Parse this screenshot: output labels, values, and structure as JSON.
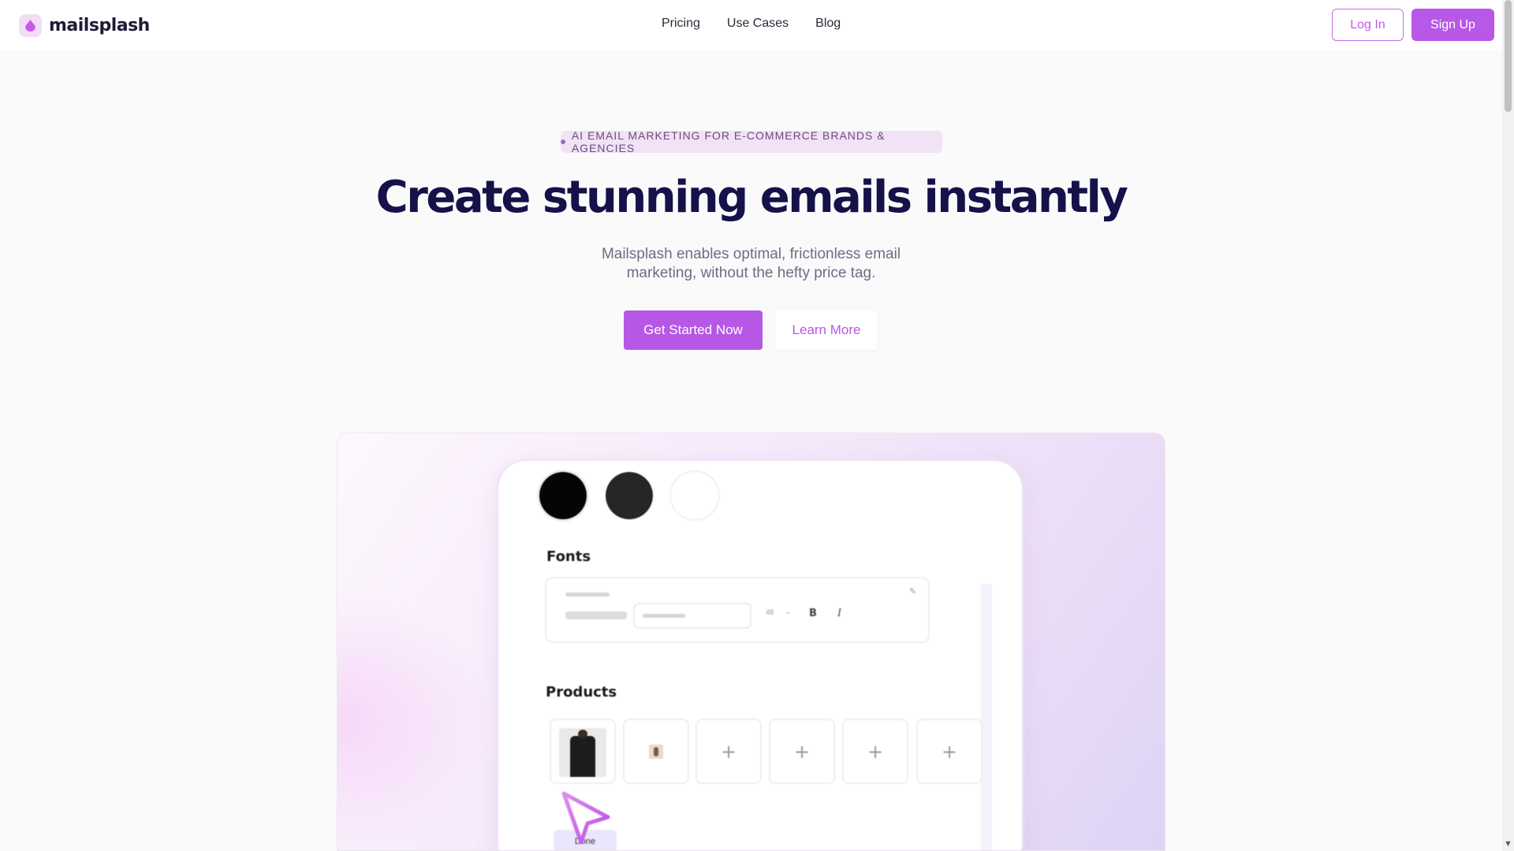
{
  "header": {
    "brand": "mailsplash",
    "nav": [
      "Pricing",
      "Use Cases",
      "Blog"
    ],
    "login_label": "Log In",
    "signup_label": "Sign Up"
  },
  "hero": {
    "badge": "AI EMAIL MARKETING FOR E-COMMERCE BRANDS & AGENCIES",
    "title": "Create stunning emails instantly",
    "subtitle": "Mailsplash enables optimal, frictionless email marketing, without the hefty price tag.",
    "primary_cta": "Get Started Now",
    "secondary_cta": "Learn More"
  },
  "editor_preview": {
    "color_swatches": [
      "#050505",
      "#262626",
      "#ffffff"
    ],
    "fonts_label": "Fonts",
    "font_size": "48",
    "bold_label": "B",
    "italic_label": "I",
    "products_label": "Products",
    "product_slots": [
      "shirt-photo",
      "product-photo",
      "+",
      "+",
      "+",
      "+"
    ],
    "done_label": "Done"
  },
  "colors": {
    "accent": "#b658e5",
    "heading": "#15124a"
  }
}
